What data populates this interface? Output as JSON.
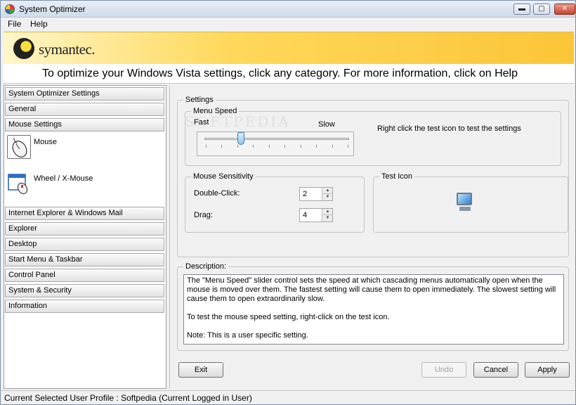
{
  "window": {
    "title": "System Optimizer",
    "controls": {
      "minimize": "▬",
      "maximize": "▢",
      "close": "✕"
    }
  },
  "menu": {
    "file": "File",
    "help": "Help"
  },
  "banner": {
    "logo_text": "symantec.",
    "instruction": "To optimize your Windows Vista settings, click any category. For more information, click on Help"
  },
  "sidebar": {
    "categories_top": [
      {
        "label": "System Optimizer Settings"
      },
      {
        "label": "General"
      },
      {
        "label": "Mouse Settings"
      }
    ],
    "subitems": [
      {
        "label": "Mouse",
        "icon": "mouse-icon"
      },
      {
        "label": "Wheel / X-Mouse",
        "icon": "wheel-mouse-icon"
      }
    ],
    "categories_bottom": [
      {
        "label": "Internet Explorer & Windows Mail"
      },
      {
        "label": "Explorer"
      },
      {
        "label": "Desktop"
      },
      {
        "label": "Start Menu & Taskbar"
      },
      {
        "label": "Control Panel"
      },
      {
        "label": "System & Security"
      },
      {
        "label": "Information"
      }
    ]
  },
  "settings": {
    "legend": "Settings",
    "menu_speed": {
      "legend": "Menu Speed",
      "fast_label": "Fast",
      "slow_label": "Slow",
      "level": 0.25
    },
    "hint": "Right click the test icon to test the settings",
    "mouse_sensitivity": {
      "legend": "Mouse Sensitivity",
      "double_click_label": "Double-Click:",
      "double_click_value": "2",
      "drag_label": "Drag:",
      "drag_value": "4"
    },
    "test_icon": {
      "legend": "Test Icon",
      "icon": "monitor-icon"
    }
  },
  "description": {
    "legend": "Description:",
    "paragraphs": [
      "The \"Menu Speed\" slider control sets the speed at which cascading menus automatically open when the mouse is moved over them. The fastest setting will cause them to open immediately. The slowest setting will cause them to open extraordinarily slow.",
      "To test the mouse speed setting, right-click on the test icon.",
      "Note: This is a user specific setting."
    ]
  },
  "buttons": {
    "exit": "Exit",
    "undo": "Undo",
    "cancel": "Cancel",
    "apply": "Apply"
  },
  "status": {
    "text": "Current Selected User Profile :  Softpedia (Current Logged in User)"
  },
  "watermark": "SOFTPEDIA"
}
